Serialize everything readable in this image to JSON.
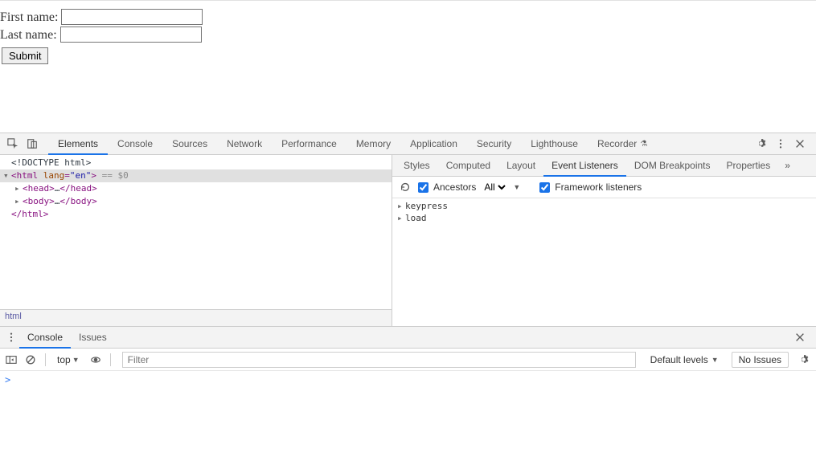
{
  "page": {
    "form": {
      "first_label": "First name:",
      "last_label": "Last name:",
      "submit_label": "Submit"
    }
  },
  "devtools": {
    "tabs": [
      "Elements",
      "Console",
      "Sources",
      "Network",
      "Performance",
      "Memory",
      "Application",
      "Security",
      "Lighthouse",
      "Recorder"
    ],
    "active_tab": "Elements",
    "dom": {
      "line0": "<!DOCTYPE html>",
      "line1_open": "<html ",
      "line1_attr_name": "lang",
      "line1_attr_val": "\"en\"",
      "line1_close": ">",
      "line1_suffix": " == $0",
      "line2_open": "<head>",
      "line2_ellipsis": "…",
      "line2_close": "</head>",
      "line3_open": "<body>",
      "line3_ellipsis": "…",
      "line3_close": "</body>",
      "line4": "</html>"
    },
    "breadcrumb": "html",
    "sidebar": {
      "tabs": [
        "Styles",
        "Computed",
        "Layout",
        "Event Listeners",
        "DOM Breakpoints",
        "Properties"
      ],
      "active_tab": "Event Listeners",
      "toolbar": {
        "ancestors_label": "Ancestors",
        "scope_options": [
          "All"
        ],
        "scope_selected": "All",
        "framework_label": "Framework listeners"
      },
      "events": [
        "keypress",
        "load"
      ]
    }
  },
  "console": {
    "tabs": [
      "Console",
      "Issues"
    ],
    "active_tab": "Console",
    "context": "top",
    "filter_placeholder": "Filter",
    "levels": "Default levels",
    "issues_btn": "No Issues",
    "prompt": ">"
  }
}
